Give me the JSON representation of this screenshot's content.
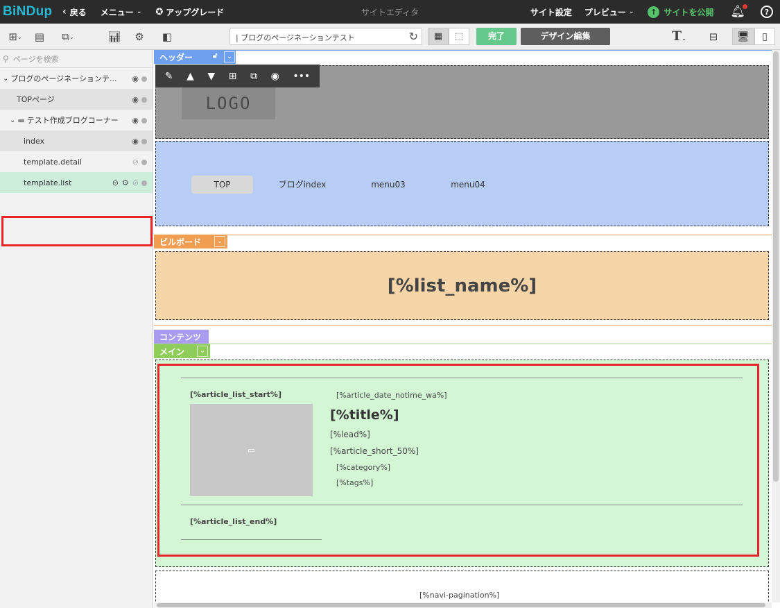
{
  "topbar": {
    "logo": "BiNDup",
    "back": "戻る",
    "menu": "メニュー",
    "upgrade": "アップグレード",
    "title": "サイトエディタ",
    "site_settings": "サイト設定",
    "preview": "プレビュー",
    "publish": "サイトを公開"
  },
  "toolbar": {
    "url": "| ブログのページネーションテスト",
    "done": "完了",
    "design_edit": "デザイン編集",
    "text_button": "T"
  },
  "sidebar": {
    "search_placeholder": "ページを検索",
    "items": [
      {
        "label": "ブログのページネーションテ...",
        "expand": "⌄"
      },
      {
        "label": "TOPページ"
      },
      {
        "label": "テスト作成ブログコーナー",
        "expand": "⌄"
      },
      {
        "label": "index"
      },
      {
        "label": "template.detail"
      },
      {
        "label": "template.list"
      }
    ]
  },
  "canvas": {
    "header_tag": "ヘッダー",
    "logo": "LOGO",
    "nav": [
      "TOP",
      "ブログindex",
      "menu03",
      "menu04"
    ],
    "billboard_tag": "ビルボード",
    "billboard_text": "[%list_name%]",
    "contents_tag": "コンテンツ",
    "main_tag": "メイン",
    "list_start": "[%article_list_start%]",
    "date": "[%article_date_notime_wa%]",
    "title": "[%title%]",
    "lead": "[%lead%]",
    "short": "[%article_short_50%]",
    "category": "[%category%]",
    "tags": "[%tags%]",
    "list_end": "[%article_list_end%]",
    "pagination": "[%navi-pagination%]"
  },
  "colors": {
    "header_tag": "#6fa0ef",
    "billboard_tag": "#f19d52",
    "contents_tag": "#a99bef",
    "main_tag": "#8fcd5a",
    "highlight": "#e8242b",
    "accent": "#27b8d4"
  }
}
